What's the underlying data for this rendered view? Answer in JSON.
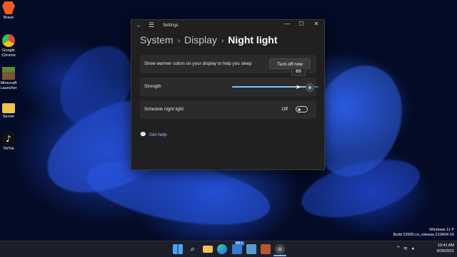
{
  "desktop_icons": [
    {
      "label": "Brave",
      "icon": "brave-icon",
      "color": "#f05a24"
    },
    {
      "label": "Google Chrome",
      "icon": "chrome-icon",
      "color": "#dd4b39"
    },
    {
      "label": "Minecraft Launcher",
      "icon": "minecraft-icon",
      "color": "#5a8a33"
    },
    {
      "label": "Server",
      "icon": "folder-icon",
      "color": "#f2c14e"
    },
    {
      "label": "TikTok",
      "icon": "tiktok-icon",
      "color": "#111111"
    }
  ],
  "window": {
    "title": "Settings",
    "back_glyph": "←",
    "menu_glyph": "☰",
    "minimize_glyph": "—",
    "maximize_glyph": "☐",
    "close_glyph": "✕"
  },
  "breadcrumb": {
    "items": [
      "System",
      "Display",
      "Night light"
    ],
    "separator": "›"
  },
  "night_light": {
    "description": "Show warmer colors on your display to help you sleep",
    "turn_off_label": "Turn off now",
    "strength_label": "Strength",
    "strength_value": "89",
    "strength_fraction": 0.89,
    "schedule_label": "Schedule night light",
    "schedule_state": "Off"
  },
  "help": {
    "label": "Get help",
    "icon": "help-chat-icon"
  },
  "colors": {
    "accent": "#7ec3ff",
    "window_bg": "#202020",
    "card_bg": "#2b2b2b"
  },
  "taskbar": {
    "apps": [
      "start-icon",
      "search-icon",
      "file-explorer-icon",
      "edge-icon",
      "mail-icon",
      "store-icon",
      "notes-icon",
      "settings-icon"
    ],
    "mail_badge": "99+"
  },
  "system_tray": {
    "time": "10:41 AM",
    "date": "9/29/2021"
  },
  "watermark": {
    "line1": "Windows 11 P",
    "line2": "Build 22000.co_release.210604-16"
  }
}
